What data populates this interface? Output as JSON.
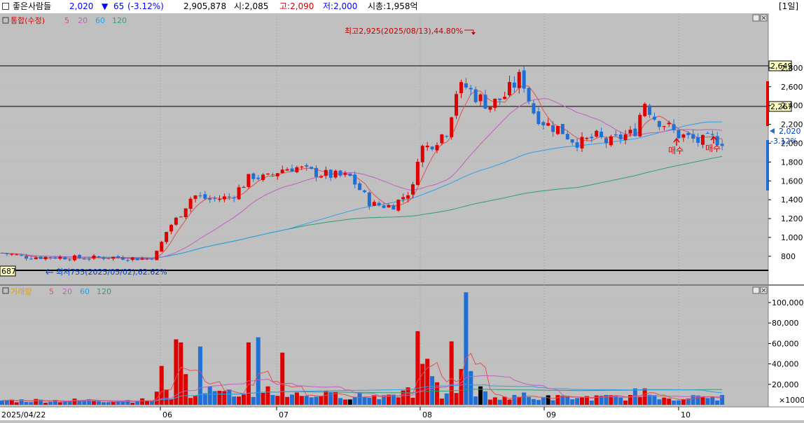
{
  "header": {
    "name": "좋은사람들",
    "price": "2,020",
    "change_arrow": "▼",
    "change": "65",
    "change_pct": "(-3.12%)",
    "volume": "2,905,878",
    "open_label": "시:2,085",
    "high_label": "고:2,090",
    "low_label": "저:2,000",
    "mcap_label": "시총:1,958억",
    "period": "[1일]"
  },
  "price_panel": {
    "legend_title": "통합(수정)",
    "legend_ma": [
      "5",
      "20",
      "60",
      "120"
    ],
    "max_note": "최고2,925(2025/08/13),44.80%",
    "min_note": "최저755(2025/05/02),62.62%",
    "hline_labels": [
      "2,649",
      "2,267"
    ],
    "min_line_label": "687",
    "current_price": "2,020",
    "current_change": "-3.12%",
    "buy_labels": [
      "매수",
      "매수"
    ],
    "y_ticks": [
      "2,800",
      "2,600",
      "2,400",
      "2,200",
      "2,000",
      "1,800",
      "1,600",
      "1,400",
      "1,200",
      "1,000",
      "800"
    ]
  },
  "volume_panel": {
    "legend_title": "거래량",
    "legend_ma": [
      "5",
      "20",
      "60",
      "120"
    ],
    "y_ticks": [
      "100,000",
      "80,000",
      "60,000",
      "40,000",
      "20,000"
    ],
    "unit_label": "×1000"
  },
  "x_axis": {
    "labels": [
      "2025/04/22",
      "06",
      "07",
      "08",
      "09",
      "10"
    ]
  },
  "colors": {
    "up": "#e00000",
    "down": "#1f6fd6",
    "ma5": "#e05050",
    "ma20": "#c060c0",
    "ma60": "#2aa0e8",
    "ma120": "#30a070"
  }
}
